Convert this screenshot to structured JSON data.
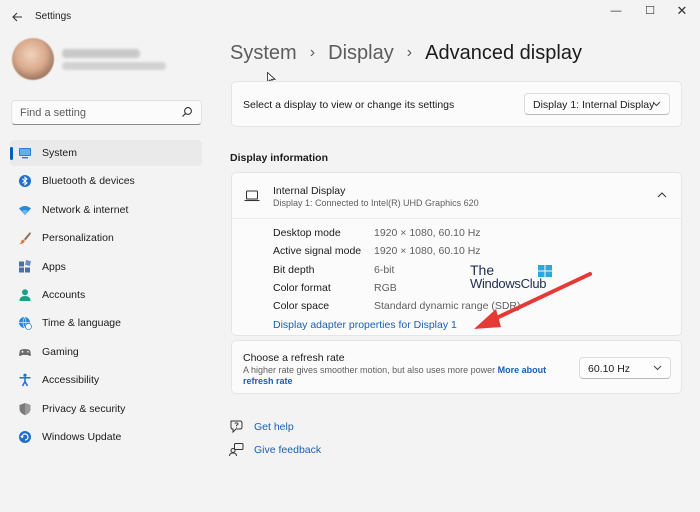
{
  "window": {
    "app_title": "Settings",
    "controls": {
      "minimize": "—",
      "maximize": "☐",
      "close": "✕"
    }
  },
  "sidebar": {
    "search_placeholder": "Find a setting",
    "items": [
      {
        "label": "System",
        "icon": "system-icon",
        "selected": true
      },
      {
        "label": "Bluetooth & devices",
        "icon": "bluetooth-icon"
      },
      {
        "label": "Network & internet",
        "icon": "wifi-icon"
      },
      {
        "label": "Personalization",
        "icon": "brush-icon"
      },
      {
        "label": "Apps",
        "icon": "apps-icon"
      },
      {
        "label": "Accounts",
        "icon": "person-icon"
      },
      {
        "label": "Time & language",
        "icon": "globe-clock-icon"
      },
      {
        "label": "Gaming",
        "icon": "gamepad-icon"
      },
      {
        "label": "Accessibility",
        "icon": "accessibility-icon"
      },
      {
        "label": "Privacy & security",
        "icon": "shield-icon"
      },
      {
        "label": "Windows Update",
        "icon": "update-icon"
      }
    ]
  },
  "breadcrumb": {
    "items": [
      "System",
      "Display"
    ],
    "separator": "›",
    "current": "Advanced display"
  },
  "display_select": {
    "label": "Select a display to view or change its settings",
    "value": "Display 1: Internal Display"
  },
  "display_info": {
    "section_title": "Display information",
    "title": "Internal Display",
    "subtitle": "Display 1: Connected to Intel(R) UHD Graphics 620",
    "rows": [
      {
        "key": "Desktop mode",
        "value": "1920 × 1080, 60.10 Hz"
      },
      {
        "key": "Active signal mode",
        "value": "1920 × 1080, 60.10 Hz"
      },
      {
        "key": "Bit depth",
        "value": "6-bit"
      },
      {
        "key": "Color format",
        "value": "RGB"
      },
      {
        "key": "Color space",
        "value": "Standard dynamic range (SDR)"
      }
    ],
    "adapter_link": "Display adapter properties for Display 1"
  },
  "refresh_rate": {
    "title": "Choose a refresh rate",
    "description": "A higher rate gives smoother motion, but also uses more power",
    "more_link": "More about refresh rate",
    "value": "60.10 Hz"
  },
  "help": {
    "get_help": "Get help",
    "give_feedback": "Give feedback"
  },
  "watermark": {
    "line1": "The",
    "line2": "WindowsClub"
  },
  "colors": {
    "accent": "#005fb8",
    "link": "#1a5fb4",
    "annotation_arrow": "#e53935"
  }
}
